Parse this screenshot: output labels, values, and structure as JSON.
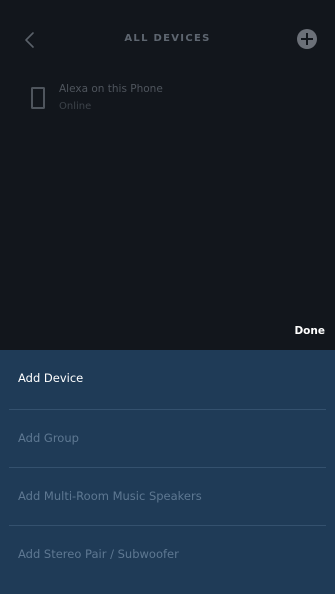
{
  "header": {
    "title": "ALL DEVICES",
    "back_icon": "chevron-left-icon",
    "add_icon": "plus-circle-icon"
  },
  "devices": [
    {
      "name": "Alexa on this Phone",
      "status": "Online",
      "icon": "phone-icon"
    }
  ],
  "done_label": "Done",
  "menu": {
    "items": [
      {
        "label": "Add Device"
      },
      {
        "label": "Add Group"
      },
      {
        "label": "Add Multi-Room Music Speakers"
      },
      {
        "label": "Add Stereo Pair / Subwoofer"
      }
    ]
  },
  "colors": {
    "background": "#12161c",
    "sheet": "#1f3b57",
    "sheet_divider": "#34516e",
    "primary_text": "#ffffff",
    "muted_text": "#5e7892"
  }
}
